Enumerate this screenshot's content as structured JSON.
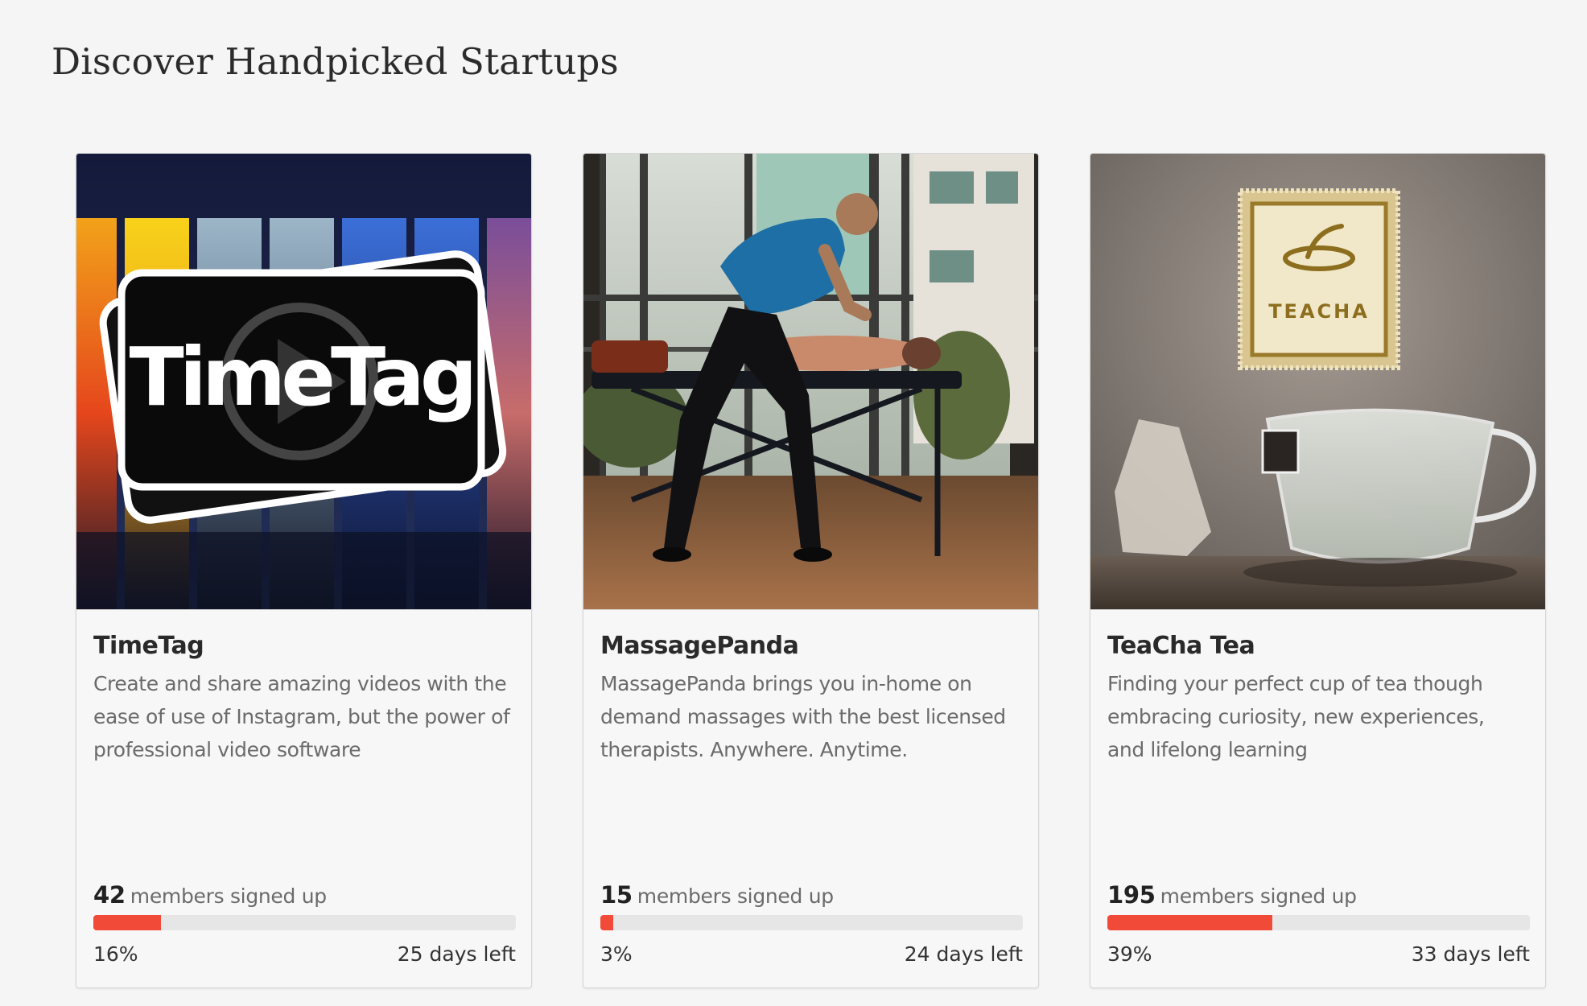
{
  "page": {
    "title": "Discover Handpicked Startups"
  },
  "colors": {
    "background": "#f5f5f5",
    "progress_fill": "#f14a39",
    "progress_track": "#e6e6e6"
  },
  "cards": [
    {
      "name": "TimeTag",
      "description": "Create and share amazing videos with the ease of use of Instagram, but the power of professional video software",
      "members_count": "42",
      "members_label": "members signed up",
      "percent": "16%",
      "progress": 0.16,
      "days_left": "25 days left",
      "image": {
        "icon": "timetag-logo",
        "logo_text": "TimeTag"
      }
    },
    {
      "name": "MassagePanda",
      "description": "MassagePanda brings you in-home on demand massages with the best licensed therapists. Anywhere. Anytime.",
      "members_count": "15",
      "members_label": "members signed up",
      "percent": "3%",
      "progress": 0.03,
      "days_left": "24 days left",
      "image": {
        "icon": "massage-photo"
      }
    },
    {
      "name": "TeaCha Tea",
      "description": "Finding your perfect cup of tea though embracing curiosity, new experiences, and lifelong learning",
      "members_count": "195",
      "members_label": "members signed up",
      "percent": "39%",
      "progress": 0.39,
      "days_left": "33 days left",
      "image": {
        "icon": "teacha-tea-photo",
        "logo_text": "TEACHA"
      }
    }
  ]
}
